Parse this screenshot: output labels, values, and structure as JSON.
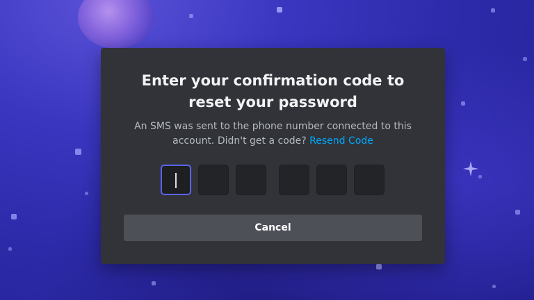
{
  "modal": {
    "title": "Enter your confirmation code to reset your password",
    "description": "An SMS was sent to the phone number connected to this account. Didn't get a code?",
    "resend_link": "Resend Code",
    "code_boxes": 6,
    "active_box": 1,
    "cancel_label": "Cancel"
  },
  "colors": {
    "modal_bg": "#313338",
    "title": "#f2f3f5",
    "text": "#b5bac1",
    "link": "#00a8fc",
    "focus_border": "#5865f2",
    "button_bg": "#4e5058",
    "background": "#2c2aa8"
  }
}
